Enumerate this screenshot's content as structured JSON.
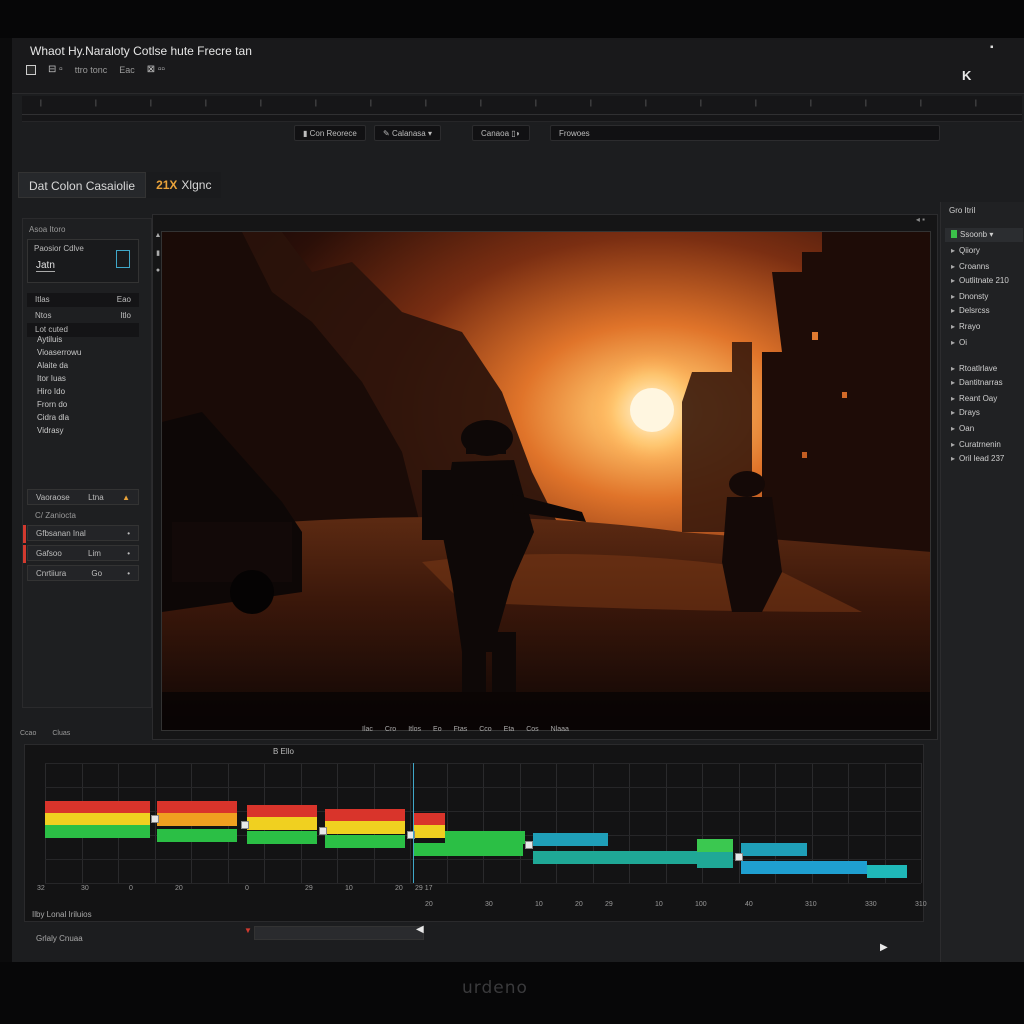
{
  "app": {
    "title": "Whaot Hy.Naraloty Cotlse hute Frecre tan",
    "window_close": "▪"
  },
  "menu": {
    "items": [
      "⊟ ▫",
      "ttro tonc",
      "Eac",
      "⊠ ▫▫"
    ]
  },
  "toolbar": {
    "btn_a": "Con Reorece",
    "btn_b": "Calanasa",
    "btn_c": "Canaoa",
    "btn_d": "Frowoes",
    "k_label": "K"
  },
  "tabs": {
    "tab1": "Dat  Colon Casaiolie",
    "tab2_accent": "21X",
    "tab2": "Xlgnc"
  },
  "left_panel": {
    "header": "Asoa Itoro",
    "box_line1": "Paosior Cdlve",
    "box_line2": "Jatn",
    "row1_left": "Itlas",
    "row1_right": "Eao",
    "row2_left": "Ntos",
    "row2_right": "Itlo",
    "row3": "Lot cuted",
    "list": [
      "Aytiluis",
      "Vioaserrowu",
      "Alaite da",
      "Itor Iuas",
      "Hiro Ido",
      "Frorn do",
      "Cidra dla",
      "Vidrasy"
    ],
    "ctrl1_left": "Vaoraose",
    "ctrl1_mid": "Ltna",
    "ctrl1_warn": "▲",
    "label_sub": "C/ Zaniocta",
    "ctrl2": "Gfbsanan Inal",
    "ctrl3_left": "Gafsoo",
    "ctrl3_right": "Lim",
    "ctrl4_left": "Cnrtiiura",
    "ctrl4_right": "Go"
  },
  "viewer": {
    "corner": "◂ ▪"
  },
  "right_panel": {
    "header": "Gro Itril",
    "items": [
      {
        "label": "Ssoonb ▾",
        "sel": true
      },
      {
        "label": "Qiiory"
      },
      {
        "label": "Croanns"
      },
      {
        "label": "Outlitnate  210"
      },
      {
        "label": "Dnonsty"
      },
      {
        "label": "Delsrcss"
      },
      {
        "label": "Rrayo"
      },
      {
        "label": "Oi"
      },
      {
        "label": "Rtoatlrlave"
      },
      {
        "label": "Dantitnarras"
      },
      {
        "label": "Reant Oay"
      },
      {
        "label": "Drays"
      },
      {
        "label": "Oan"
      },
      {
        "label": "Curatrnenin"
      },
      {
        "label": "Oril lead  237"
      }
    ]
  },
  "timeline_controls": {
    "labels": [
      "Ilac",
      "Cro",
      "Itlos",
      "Eo",
      "Ftas",
      "Cco",
      "Eta",
      "Cos",
      "Nlaaa"
    ],
    "left_labels": [
      "Ccao",
      "Cluas"
    ],
    "title": "B Ello"
  },
  "timeline": {
    "scale_left": [
      "32",
      "30",
      "0",
      "20",
      "0",
      "29",
      "10",
      "20",
      "29 17"
    ],
    "scale_right": [
      "20",
      "30",
      "10",
      "20",
      "29",
      "10",
      "100",
      "40",
      "310",
      "330",
      "310"
    ]
  },
  "bottom": {
    "label1": "Ilby Lonal Iriluios",
    "label2": "Grlaly Cnuaa",
    "marker": "▼"
  },
  "monitor": {
    "brand": "urdeno"
  },
  "colors": {
    "accent_orange": "#e8a23a",
    "accent_blue": "#3fa7c8",
    "accent_green": "#3bbf4a",
    "accent_red": "#d23a2f"
  }
}
